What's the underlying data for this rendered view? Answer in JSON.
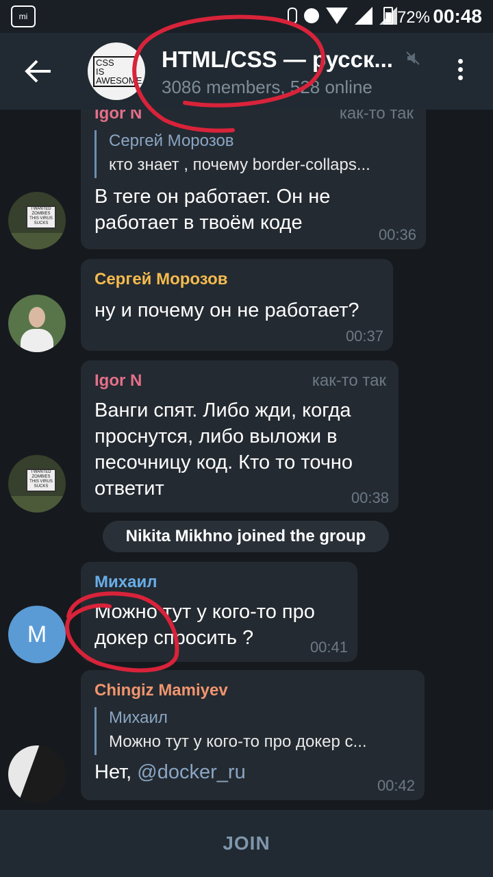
{
  "status_bar": {
    "battery": "72%",
    "time": "00:48"
  },
  "header": {
    "title": "HTML/CSS — русск...",
    "subtitle": "3086 members, 528 online",
    "avatar_text": "CSS\nIS\nAWESOME"
  },
  "messages": [
    {
      "sender": "Igor N",
      "badge": "как-то так",
      "reply_name": "Сергей Морозов",
      "reply_text": "кто знает , почему border-collaps...",
      "text_lines": [
        "В теге он работает. Он не",
        "работает в твоём коде"
      ],
      "time": "00:36"
    },
    {
      "sender": "Сергей Морозов",
      "text_lines": [
        "ну и почему он не работает?"
      ],
      "time": "00:37"
    },
    {
      "sender": "Igor N",
      "badge": "как-то так",
      "text_lines": [
        "Ванги спят. Либо жди, когда",
        "проснутся, либо выложи в",
        "песочницу код. Кто то точно",
        "ответит"
      ],
      "time": "00:38"
    },
    {
      "sender": "Михаил",
      "text_lines": [
        "Можно тут у кого-то про",
        "докер спросить ?"
      ],
      "time": "00:41",
      "avatar_letter": "M"
    },
    {
      "sender": "Chingiz Mamiyev",
      "reply_name": "Михаил",
      "reply_text": "Можно тут у кого-то про докер с...",
      "text_prefix": "Нет, ",
      "mention": "@docker_ru",
      "time": "00:42"
    }
  ],
  "service_message": "Nikita Mikhno joined the group",
  "join_label": "JOIN",
  "colors": {
    "igor": "#e5708a",
    "sergey": "#f4bb4f",
    "mikhail": "#68aee8",
    "chingiz": "#f0956e",
    "annotation": "#d8233a"
  }
}
